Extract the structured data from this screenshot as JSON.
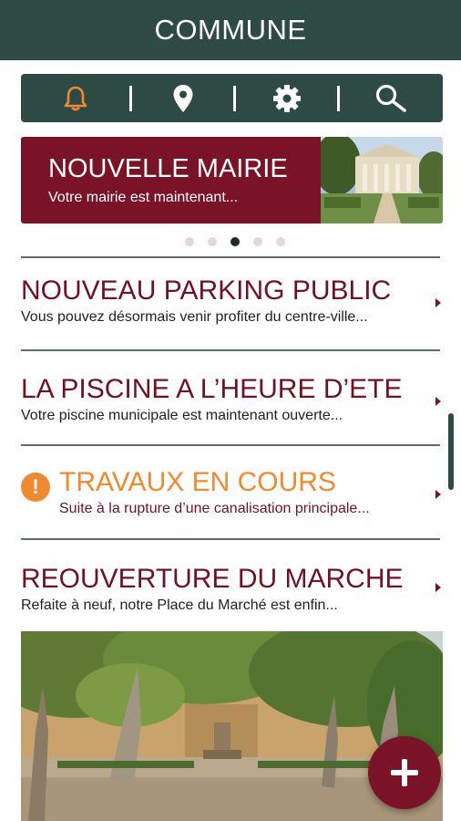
{
  "app": {
    "title": "COMMUNE"
  },
  "toolbar": {
    "items": [
      {
        "icon": "bell-icon",
        "color": "#ee8a31",
        "active": true
      },
      {
        "icon": "location-pin-icon",
        "color": "#ffffff",
        "active": false
      },
      {
        "icon": "gear-icon",
        "color": "#ffffff",
        "active": false
      },
      {
        "icon": "search-icon",
        "color": "#ffffff",
        "active": false
      }
    ]
  },
  "banner": {
    "title": "NOUVELLE MAIRIE",
    "subtitle": "Votre mairie est maintenant...",
    "image": "town-hall-photo",
    "background": "#7a1327"
  },
  "carousel": {
    "count": 5,
    "active_index": 2
  },
  "news": [
    {
      "title": "NOUVEAU PARKING PUBLIC",
      "subtitle": "Vous pouvez désormais venir profiter du centre-ville...",
      "alert": false
    },
    {
      "title": "LA PISCINE A L’HEURE D’ETE",
      "subtitle": "Votre piscine municipale est maintenant ouverte...",
      "alert": false
    },
    {
      "title": "TRAVAUX EN COURS",
      "subtitle": "Suite à la rupture d’une canalisation principale...",
      "alert": true,
      "icon": "warning-icon"
    },
    {
      "title": "REOUVERTURE DU MARCHE",
      "subtitle": "Refaite à neuf, notre Place du Marché est enfin...",
      "alert": false,
      "image": "market-square-photo"
    }
  ],
  "fab": {
    "icon": "plus-icon"
  },
  "colors": {
    "header": "#2e4a45",
    "accent": "#7a1327",
    "alert": "#ee8a31"
  }
}
